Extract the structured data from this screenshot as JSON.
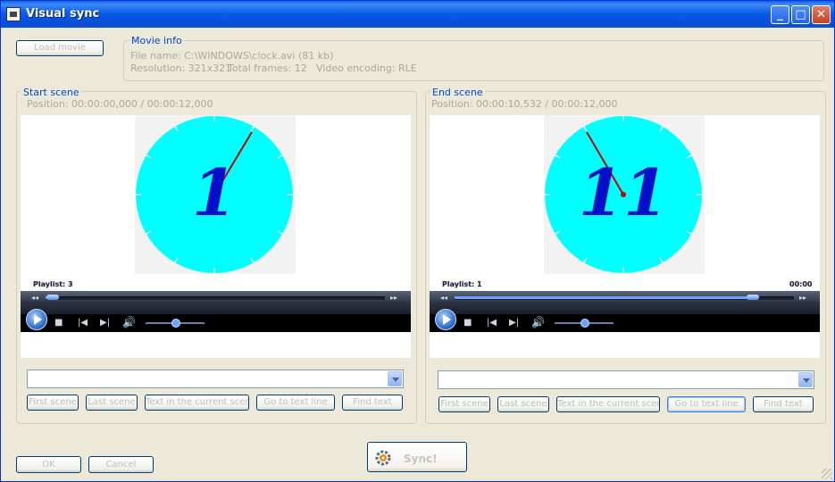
{
  "window": {
    "title": "Visual sync",
    "title_icon": "media-file-icon",
    "controls": {
      "minimize": "_",
      "maximize": "□",
      "close": "✕"
    }
  },
  "toolbar": {
    "load_label": "Load movie"
  },
  "movie_info": {
    "legend": "Movie info",
    "file_line": "File name: C:\\WINDOWS\\clock.avi (81 kb)",
    "resolution": "Resolution: 321x321",
    "frames": "Total frames: 12",
    "encoding": "Video encoding: RLE"
  },
  "start_scene": {
    "legend": "Start scene",
    "position": "Position: 00:00:00,000 / 00:00:12,000",
    "playlist": "Playlist: 3",
    "time_right": "",
    "clock_number": "1",
    "seek_fraction": 0.02,
    "volume_fraction": 0.5,
    "combo_value": "",
    "buttons": [
      "First scene",
      "Last scene",
      "Text in the current scene",
      "Go to text line",
      "Find text"
    ]
  },
  "end_scene": {
    "legend": "End scene",
    "position": "Position: 00:00:10,532 / 00:00:12,000",
    "playlist": "Playlist: 1",
    "time_right": "00:00",
    "clock_number": "11",
    "seek_fraction": 0.88,
    "volume_fraction": 0.5,
    "combo_value": "",
    "buttons": [
      "First scene",
      "Last scene",
      "Text in the current scene",
      "Go to text line",
      "Find text"
    ]
  },
  "footer": {
    "ok_label": "OK",
    "cancel_label": "Cancel",
    "sync_label": "Sync!"
  },
  "colors": {
    "clock_face": "#00ffff",
    "clock_numeral": "#0010c8",
    "clock_hand": "#c80000",
    "legend_text": "#0046d5",
    "titlebar": "#0a5fe6"
  }
}
